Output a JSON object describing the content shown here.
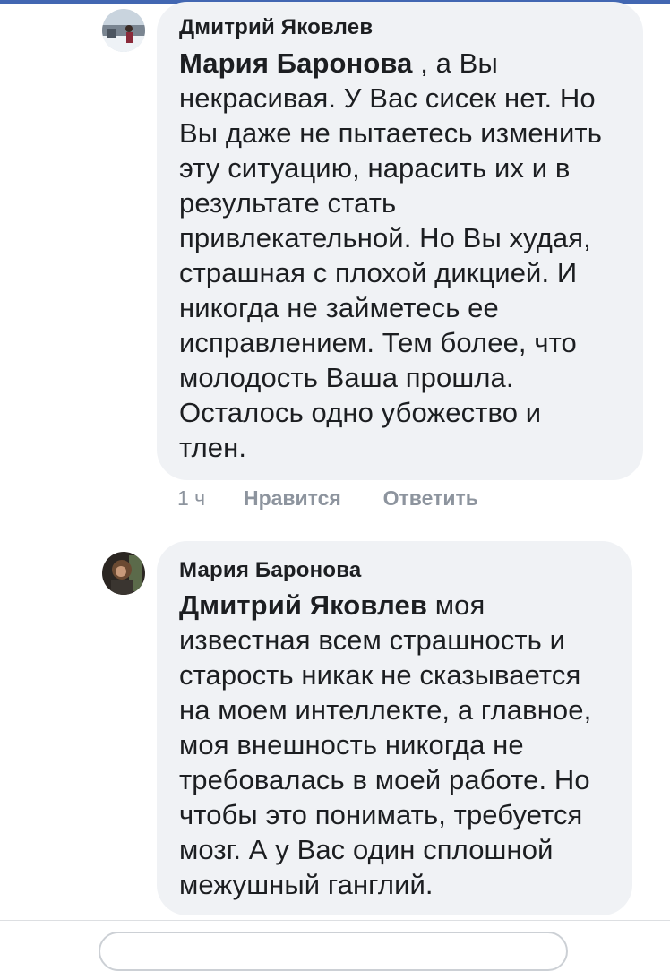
{
  "comments": [
    {
      "author": "Дмитрий Яковлев",
      "mention": "Мария Баронова",
      "text_lines": [
        " , а Вы",
        "некрасивая. У Вас сисек нет. Но",
        "Вы даже не пытаетесь изменить",
        "эту ситуацию, нарасить их и в",
        "результате стать",
        "привлекательной. Но Вы худая,",
        "страшная с плохой дикцией. И",
        "никогда не займетесь ее",
        "исправлением. Тем более, что",
        "молодость Ваша прошла.",
        "Осталось одно убожество и",
        "тлен."
      ],
      "time": "1 ч",
      "like_label": "Нравится",
      "reply_label": "Ответить",
      "avatar_icon": "user-avatar-icon"
    },
    {
      "author": "Мария Баронова",
      "mention": "Дмитрий Яковлев",
      "text_lines": [
        " моя",
        "известная всем страшность и",
        "старость никак не сказывается",
        "на моем интеллекте, а главное,",
        "моя внешность никогда не",
        "требовалась в моей работе. Но",
        "чтобы это понимать, требуется",
        "мозг. А у Вас один сплошной",
        "межушный ганглий."
      ],
      "avatar_icon": "user-avatar-icon"
    }
  ],
  "colors": {
    "bubble": "#f0f2f5",
    "text": "#1c1e21",
    "meta": "#8d949e",
    "accent": "#4267b2"
  }
}
